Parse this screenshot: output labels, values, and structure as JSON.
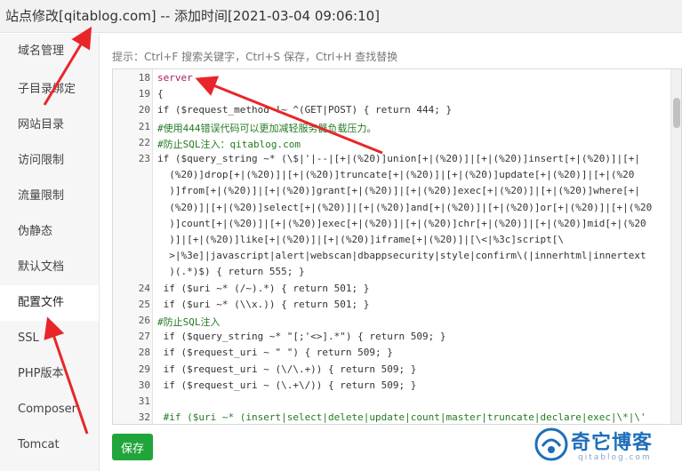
{
  "window": {
    "title": "站点修改[qitablog.com] -- 添加时间[2021-03-04 09:06:10]"
  },
  "sidebar": {
    "items": [
      {
        "label": "域名管理",
        "active": false
      },
      {
        "label": "子目录绑定",
        "active": false
      },
      {
        "label": "网站目录",
        "active": false
      },
      {
        "label": "访问限制",
        "active": false
      },
      {
        "label": "流量限制",
        "active": false
      },
      {
        "label": "伪静态",
        "active": false
      },
      {
        "label": "默认文档",
        "active": false
      },
      {
        "label": "配置文件",
        "active": true
      },
      {
        "label": "SSL",
        "active": false
      },
      {
        "label": "PHP版本",
        "active": false
      },
      {
        "label": "Composer",
        "active": false
      },
      {
        "label": "Tomcat",
        "active": false
      }
    ]
  },
  "editor": {
    "hint": "提示：Ctrl+F 搜索关键字，Ctrl+S 保存，Ctrl+H 查找替换",
    "lines": [
      {
        "n": "18",
        "text": "server"
      },
      {
        "n": "19",
        "text": "{"
      },
      {
        "n": "20",
        "text": "if ($request_method !~ ^(GET|POST) { return 444; }"
      },
      {
        "n": "21",
        "text": "#使用444错误代码可以更加减轻服务器负载压力。"
      },
      {
        "n": "22",
        "text": "#防止SQL注入：qitablog.com"
      },
      {
        "n": "23",
        "text": "if ($query_string ~* (\\$|'|--|[+|(%20)]union[+|(%20)]|[+|(%20)]insert[+|(%20)]|[+|"
      },
      {
        "n": "",
        "text": "  (%20)]drop[+|(%20)]|[+|(%20)]truncate[+|(%20)]|[+|(%20)]update[+|(%20)]|[+|(%20"
      },
      {
        "n": "",
        "text": "  )]from[+|(%20)]|[+|(%20)]grant[+|(%20)]|[+|(%20)]exec[+|(%20)]|[+|(%20)]where[+|"
      },
      {
        "n": "",
        "text": "  (%20)]|[+|(%20)]select[+|(%20)]|[+|(%20)]and[+|(%20)]|[+|(%20)]or[+|(%20)]|[+|(%20"
      },
      {
        "n": "",
        "text": "  )]count[+|(%20)]|[+|(%20)]exec[+|(%20)]|[+|(%20)]chr[+|(%20)]|[+|(%20)]mid[+|(%20"
      },
      {
        "n": "",
        "text": "  )]|[+|(%20)]like[+|(%20)]|[+|(%20)]iframe[+|(%20)]|[\\<|%3c]script[\\"
      },
      {
        "n": "",
        "text": "  >|%3e]|javascript|alert|webscan|dbappsecurity|style|confirm\\(|innerhtml|innertext"
      },
      {
        "n": "",
        "text": "  )(.*)$) { return 555; }"
      },
      {
        "n": "24",
        "text": " if ($uri ~* (/~).*) { return 501; }"
      },
      {
        "n": "25",
        "text": " if ($uri ~* (\\\\x.)) { return 501; }"
      },
      {
        "n": "26",
        "text": "#防止SQL注入"
      },
      {
        "n": "27",
        "text": " if ($query_string ~* \"[;'<>].*\") { return 509; }"
      },
      {
        "n": "28",
        "text": " if ($request_uri ~ \" \") { return 509; }"
      },
      {
        "n": "29",
        "text": " if ($request_uri ~ (\\/\\.+)) { return 509; }"
      },
      {
        "n": "30",
        "text": " if ($request_uri ~ (\\.+\\/)) { return 509; }"
      },
      {
        "n": "31",
        "text": ""
      },
      {
        "n": "32",
        "text": " #if ($uri ~* (insert|select|delete|update|count|master|truncate|declare|exec|\\*|\\'"
      }
    ]
  },
  "toolbar": {
    "save_label": "保存"
  },
  "watermark": {
    "text": "奇它博客",
    "domain": "qitablog.com"
  },
  "colors": {
    "accent_green": "#20a53a",
    "arrow_red": "#e8262a",
    "watermark_blue": "#1e6fb8"
  }
}
